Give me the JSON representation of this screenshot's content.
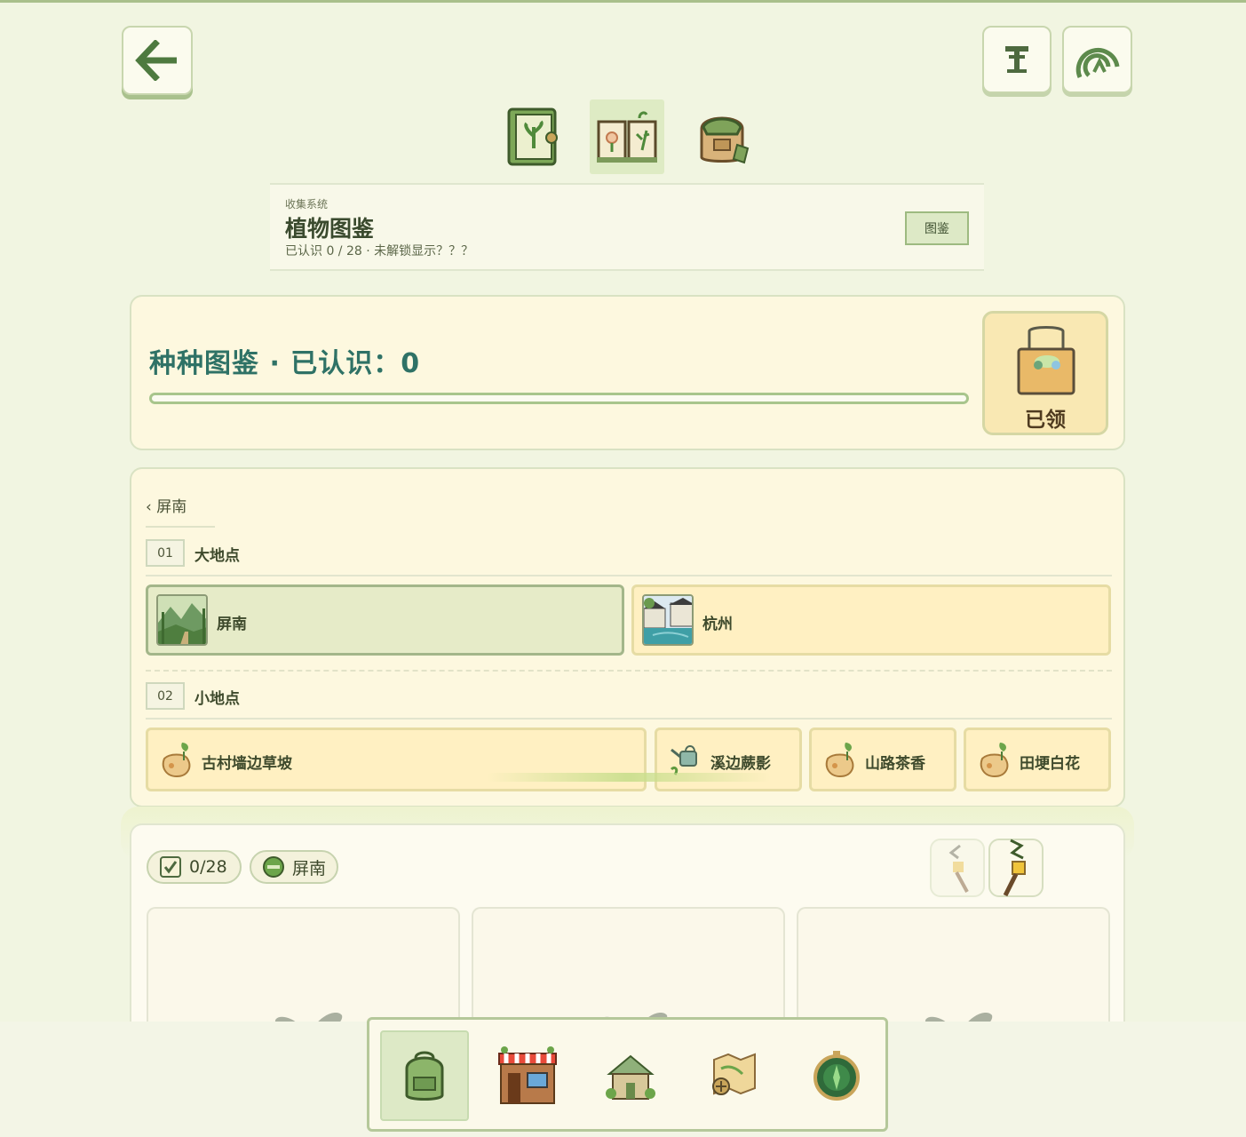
{
  "header": {
    "back_icon": "arrow-left-icon",
    "text_icon": "text-tool-icon",
    "spiral_icon": "spiral-icon"
  },
  "mode_tabs": [
    {
      "name": "green-book-icon",
      "active": false
    },
    {
      "name": "open-book-icon",
      "active": true
    },
    {
      "name": "backpack-icon",
      "active": false
    }
  ],
  "title_panel": {
    "subtitle": "收集系统",
    "title": "植物图鉴",
    "meta": "已认识 0 / 28 · 未解锁显示？？？",
    "badge": "图鉴"
  },
  "progress": {
    "title": "种种图鉴 · 已认识：0",
    "value": 0,
    "reward_label": "已领"
  },
  "locations": {
    "breadcrumb": "‹ 屏南",
    "big_section": {
      "num": "01",
      "label": "大地点"
    },
    "big_items": [
      {
        "label": "屏南",
        "active": true
      },
      {
        "label": "杭州",
        "active": false
      }
    ],
    "small_section": {
      "num": "02",
      "label": "小地点"
    },
    "small_items": [
      {
        "label": "古村墙边草坡"
      },
      {
        "label": "溪边蕨影"
      },
      {
        "label": "山路茶香"
      },
      {
        "label": "田埂白花"
      }
    ]
  },
  "collection": {
    "count": "0/28",
    "region": "屏南"
  },
  "bottom_nav": [
    {
      "name": "nav-backpack-icon",
      "active": true
    },
    {
      "name": "nav-shop-icon",
      "active": false
    },
    {
      "name": "nav-cottage-icon",
      "active": false
    },
    {
      "name": "nav-map-icon",
      "active": false
    },
    {
      "name": "nav-compass-icon",
      "active": false
    }
  ],
  "colors": {
    "background": "#f1f5e1",
    "accent_teal": "#2f7266",
    "accent_green": "#a9c18d",
    "card_cream": "#fdf8df",
    "tile_yellow": "#fff0c2"
  }
}
